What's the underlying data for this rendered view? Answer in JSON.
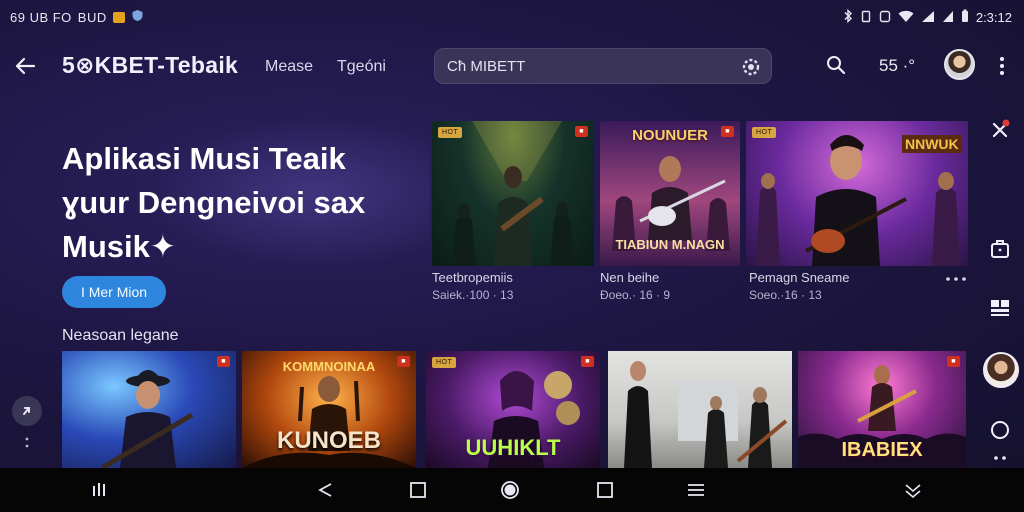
{
  "status_bar": {
    "left_text": "69 UB FO",
    "left_text_2": "BUD",
    "time": "2:3:12"
  },
  "top_bar": {
    "brand": "5⊗KBET-Tebaik",
    "nav_items": [
      "Mease",
      "Tgeóni"
    ],
    "search_value": "Cħ MIBETT",
    "counter": "55 ·°"
  },
  "hero": {
    "title_lines": [
      "Aplikasi Musi Teaik",
      "ɣuur Dengneivoi sax",
      "Musik✦"
    ],
    "cta_label": "I Mer Mion"
  },
  "featured": [
    {
      "title": "Teetbropemiis",
      "meta": "Saiek.·100 · 13",
      "poster_text": "",
      "colors": {
        "bg1": "#0d2a1e",
        "bg2": "#38502a",
        "glow": "#e3c04c"
      }
    },
    {
      "title": "Nen beihe",
      "meta": "Ðoeo.· 16 · 9",
      "poster_text_top": "NOUNUER",
      "poster_text_bottom": "TIABIUN M.NAGN",
      "colors": {
        "bg1": "#2b1744",
        "bg2": "#a2457b",
        "glow": "#f2a64a"
      }
    },
    {
      "title": "Pemagn Sneame",
      "meta": "Soeo.·16 · 13",
      "poster_text": "NNWUK",
      "colors": {
        "bg1": "#3a1a6e",
        "bg2": "#c14fd6",
        "glow": "#f0b3ff"
      }
    }
  ],
  "section2": {
    "title": "Neasoan legane",
    "cards": [
      {
        "poster_text": "",
        "colors": {
          "bg1": "#1c2b7a",
          "bg2": "#48a9f0"
        }
      },
      {
        "poster_text_top": "KOMMNOINAA",
        "poster_text": "KUNOEB",
        "colors": {
          "bg1": "#5a2408",
          "bg2": "#e67a1c"
        }
      },
      {
        "poster_text": "UUHIKLT",
        "colors": {
          "bg1": "#2a0e3a",
          "bg2": "#9a35b8"
        }
      },
      {
        "poster_text": "",
        "colors": {
          "bg1": "#c9ccd0",
          "bg2": "#f1efe8"
        }
      },
      {
        "poster_text": "IBABIEX",
        "colors": {
          "bg1": "#2a1346",
          "bg2": "#d23aa8"
        }
      }
    ]
  },
  "colors": {
    "accent": "#2f86de",
    "background": "#1e1744",
    "search_bg": "#3a3558"
  }
}
